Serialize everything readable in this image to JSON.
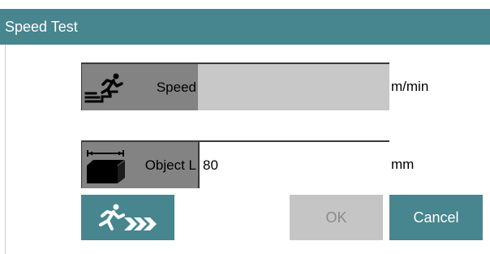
{
  "window": {
    "title": "Speed Test"
  },
  "fields": {
    "speed": {
      "label": "Speed",
      "value": "",
      "unit": "m/min"
    },
    "object_length": {
      "label": "Object L",
      "value": "80",
      "unit": "mm"
    }
  },
  "buttons": {
    "ok": "OK",
    "cancel": "Cancel"
  },
  "icons": {
    "speed": "runner-stairs-icon",
    "object": "box-length-icon",
    "run": "run-test-icon"
  },
  "colors": {
    "accent": "#47858f",
    "label_bg": "#838383",
    "readonly_bg": "#c8c8c8"
  }
}
